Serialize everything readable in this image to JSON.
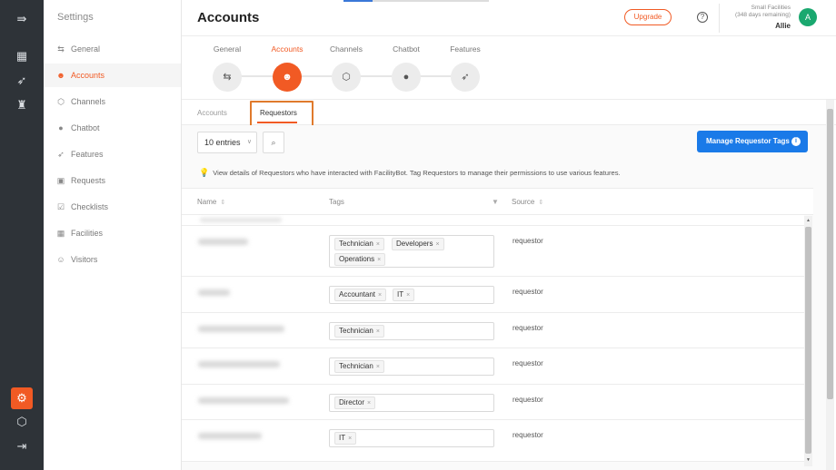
{
  "rail": {
    "icons": [
      "sidebar-toggle-icon",
      "dashboard-icon",
      "rocket-icon",
      "org-chart-icon",
      "gear-icon",
      "cube-icon",
      "logout-icon"
    ]
  },
  "sidebar": {
    "title": "Settings",
    "items": [
      {
        "label": "General",
        "icon": "sliders-icon",
        "glyph": "⇆"
      },
      {
        "label": "Accounts",
        "icon": "accounts-icon",
        "glyph": "☻"
      },
      {
        "label": "Channels",
        "icon": "channels-icon",
        "glyph": "⬡"
      },
      {
        "label": "Chatbot",
        "icon": "chat-icon",
        "glyph": "●"
      },
      {
        "label": "Features",
        "icon": "rocket-icon",
        "glyph": "➶"
      },
      {
        "label": "Requests",
        "icon": "requests-icon",
        "glyph": "▣"
      },
      {
        "label": "Checklists",
        "icon": "checklist-icon",
        "glyph": "☑"
      },
      {
        "label": "Facilities",
        "icon": "facilities-icon",
        "glyph": "▦"
      },
      {
        "label": "Visitors",
        "icon": "visitors-icon",
        "glyph": "☺"
      }
    ],
    "active": "Accounts"
  },
  "header": {
    "title": "Accounts",
    "upgrade_label": "Upgrade",
    "help_glyph": "?",
    "org_name": "Small Facilities",
    "org_days": "(348 days remaining)",
    "user_name": "Allie",
    "avatar_letter": "A",
    "avatar_color": "#1aa86f"
  },
  "steps": [
    {
      "label": "General",
      "glyph": "⇆"
    },
    {
      "label": "Accounts",
      "glyph": "☻"
    },
    {
      "label": "Channels",
      "glyph": "⬡"
    },
    {
      "label": "Chatbot",
      "glyph": "●"
    },
    {
      "label": "Features",
      "glyph": "➶"
    }
  ],
  "tabs": {
    "accounts": "Accounts",
    "requestors": "Requestors"
  },
  "toolbar": {
    "entries_value": "10 entries",
    "chevron": "∨",
    "search_glyph": "⌕",
    "manage_label": "Manage Requestor Tags",
    "manage_info": "i"
  },
  "hint": {
    "bulb": "💡",
    "text": "View details of Requestors who have interacted with FacilityBot. Tag Requestors to manage their permissions to use various features."
  },
  "table": {
    "columns": {
      "name": "Name",
      "tags": "Tags",
      "source": "Source"
    },
    "sort_glyph": "⇕",
    "filter_glyph": "▼",
    "rows": [
      {
        "tags": [
          "Technician",
          "Developers",
          "Operations"
        ],
        "source": "requestor"
      },
      {
        "tags": [
          "Accountant",
          "IT"
        ],
        "source": "requestor"
      },
      {
        "tags": [
          "Technician"
        ],
        "source": "requestor"
      },
      {
        "tags": [
          "Technician"
        ],
        "source": "requestor"
      },
      {
        "tags": [
          "Director"
        ],
        "source": "requestor"
      },
      {
        "tags": [
          "IT"
        ],
        "source": "requestor"
      }
    ]
  },
  "colors": {
    "accent": "#f15a24",
    "primary": "#1a7ae8",
    "rail": "#2e3338"
  }
}
